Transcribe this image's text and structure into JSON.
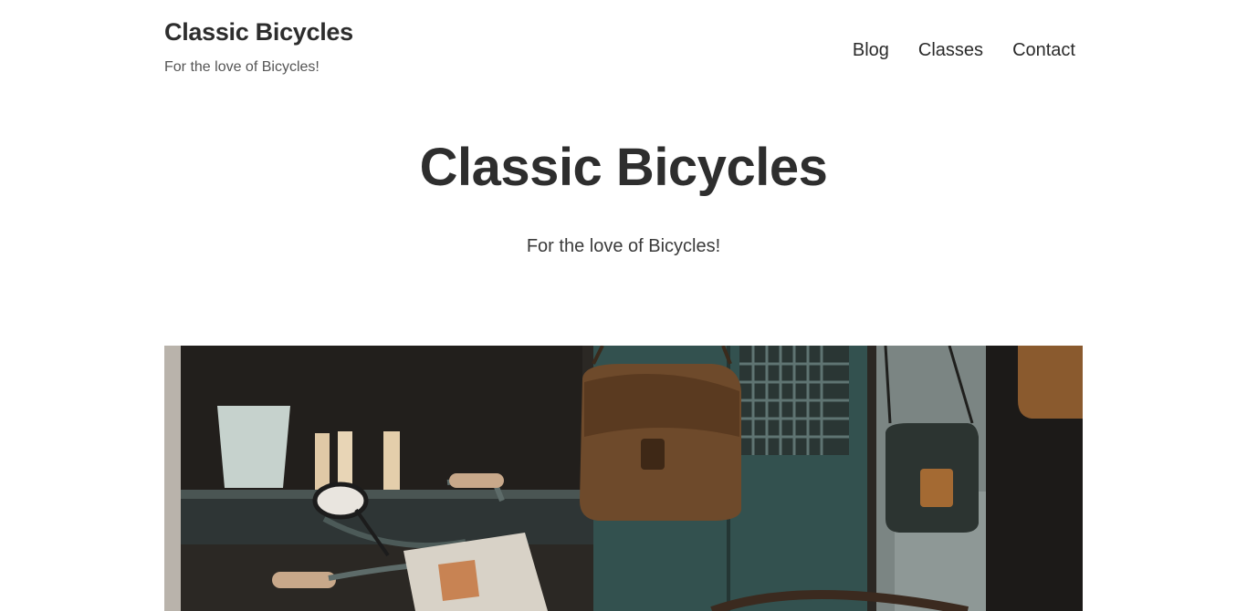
{
  "header": {
    "site_title": "Classic Bicycles",
    "tagline": "For the love of Bicycles!"
  },
  "nav": {
    "items": [
      {
        "label": "Blog"
      },
      {
        "label": "Classes"
      },
      {
        "label": "Contact"
      }
    ]
  },
  "hero": {
    "title": "Classic Bicycles",
    "tagline": "For the love of Bicycles!"
  },
  "featured_image": {
    "subject": "vintage bicycle and leather bags in a shop window"
  }
}
